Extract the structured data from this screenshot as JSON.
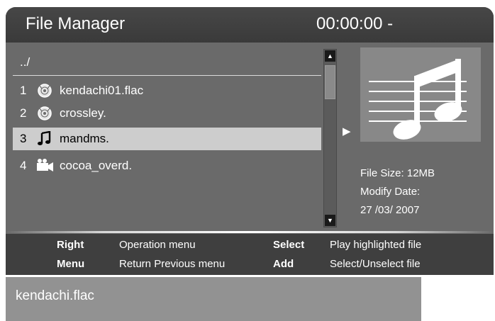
{
  "header": {
    "title": "File Manager",
    "timecode": "00:00:00 -"
  },
  "file_list": {
    "parent_dir": "../",
    "items": [
      {
        "index": "1",
        "name": "kendachi01.flac",
        "icon": "music-disc-icon",
        "highlighted": false
      },
      {
        "index": "2",
        "name": "crossley.",
        "icon": "music-disc-icon",
        "highlighted": false
      },
      {
        "index": "3",
        "name": "mandms.",
        "icon": "music-note-icon",
        "highlighted": true
      },
      {
        "index": "4",
        "name": "cocoa_overd.",
        "icon": "video-camera-icon",
        "highlighted": false
      }
    ]
  },
  "scrollbar": {
    "up_icon": "scroll-up-icon",
    "down_icon": "scroll-down-icon"
  },
  "preview": {
    "icon": "music-note-icon"
  },
  "info": {
    "file_size": "File Size: 12MB",
    "modify_label": "Modify Date:",
    "modify_date": "27 /03/ 2007"
  },
  "help": [
    {
      "key": "Right",
      "desc": "Operation menu"
    },
    {
      "key": "Select",
      "desc": "Play highlighted file"
    },
    {
      "key": "Menu",
      "desc": "Return Previous menu"
    },
    {
      "key": "Add",
      "desc": "Select/Unselect file"
    }
  ],
  "status": {
    "current_file": "kendachi.flac"
  },
  "colors": {
    "panel": "#6a6a6a",
    "titlebar": "#404040",
    "highlight": "#cdcdcd",
    "helpbar": "#3f3f3f",
    "status": "#929292"
  }
}
